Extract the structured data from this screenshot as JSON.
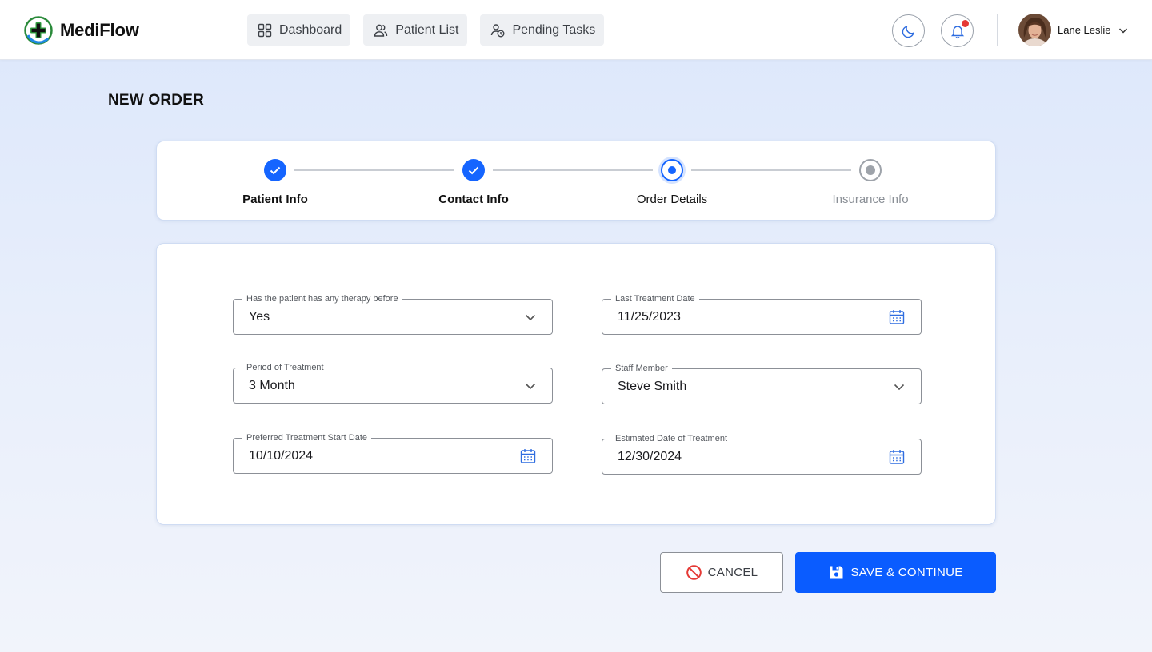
{
  "header": {
    "brand_name": "MediFlow",
    "nav": [
      {
        "label": "Dashboard",
        "icon": "grid-icon"
      },
      {
        "label": "Patient List",
        "icon": "users-icon"
      },
      {
        "label": "Pending Tasks",
        "icon": "tasks-icon"
      }
    ],
    "theme_icon": "moon-icon",
    "notification_icon": "bell-icon",
    "user_name": "Lane Leslie"
  },
  "page": {
    "title": "NEW ORDER"
  },
  "stepper": {
    "steps": [
      {
        "label": "Patient Info",
        "status": "done"
      },
      {
        "label": "Contact Info",
        "status": "done"
      },
      {
        "label": "Order Details",
        "status": "active"
      },
      {
        "label": "Insurance Info",
        "status": "todo"
      }
    ]
  },
  "form": {
    "therapy_before": {
      "label": "Has the patient has any therapy before",
      "value": "Yes"
    },
    "last_treatment_date": {
      "label": "Last Treatment Date",
      "value": "11/25/2023"
    },
    "period_of_treatment": {
      "label": "Period of Treatment",
      "value": "3 Month"
    },
    "staff_member": {
      "label": "Staff Member",
      "value": "Steve Smith"
    },
    "preferred_start_date": {
      "label": "Preferred Treatment Start Date",
      "value": "10/10/2024"
    },
    "estimated_date": {
      "label": "Estimated Date of Treatment",
      "value": "12/30/2024"
    }
  },
  "actions": {
    "cancel_label": "CANCEL",
    "save_label": "SAVE & CONTINUE"
  },
  "colors": {
    "primary": "#0a5cff",
    "brand_green": "#2e9e3e",
    "cancel_red": "#e53935",
    "notification_dot": "#e53935"
  }
}
